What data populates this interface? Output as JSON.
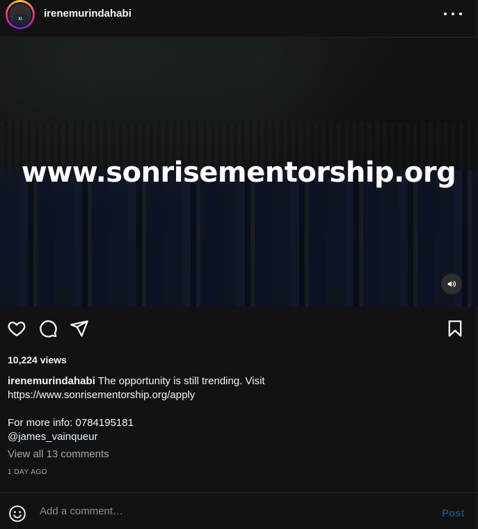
{
  "header": {
    "username": "irenemurindahabi",
    "more_icon": "more-horizontal-icon"
  },
  "media": {
    "overlay_text": "www.sonrisementorship.org",
    "audio_icon": "speaker-icon"
  },
  "actions": {
    "like_icon": "heart-icon",
    "comment_icon": "comment-bubble-icon",
    "share_icon": "send-icon",
    "save_icon": "bookmark-icon"
  },
  "stats": {
    "views": "10,224 views"
  },
  "caption": {
    "username": "irenemurindahabi",
    "line1": "The opportunity is still trending. Visit",
    "line2": "https://www.sonrisementorship.org/apply",
    "line3": "For more info: 0784195181",
    "mention": "@james_vainqueur"
  },
  "comments": {
    "view_all": "View all 13 comments"
  },
  "timestamp": "1 DAY AGO",
  "comment_bar": {
    "emoji_icon": "emoji-smile-icon",
    "placeholder": "Add a comment…",
    "post_label": "Post"
  },
  "colors": {
    "background": "#121212",
    "post_button": "#1b4a73",
    "muted_text": "#a8a8a8"
  }
}
